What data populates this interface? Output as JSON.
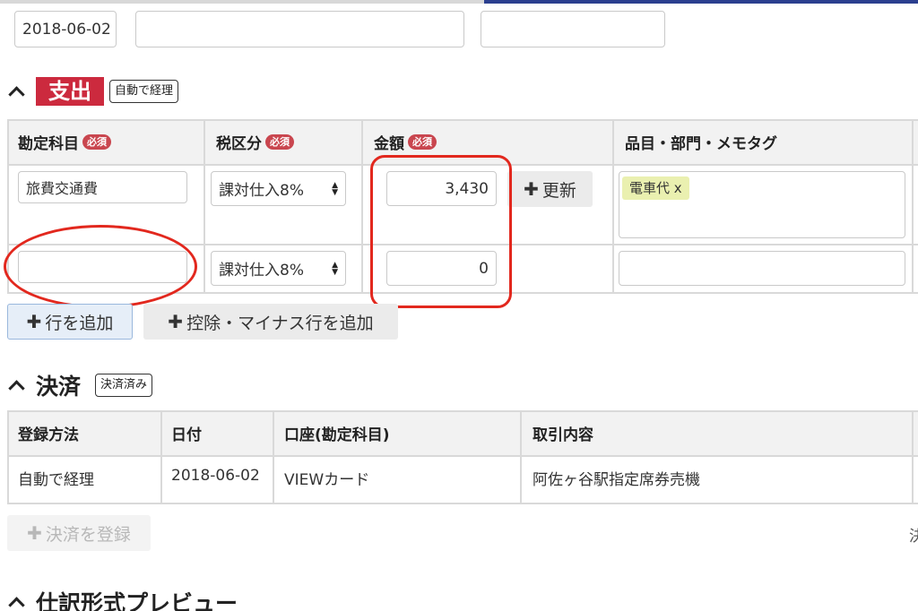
{
  "top_row": {
    "date_value": "2018-06-02",
    "field2_value": "",
    "field3_value": ""
  },
  "expense_section": {
    "title": "支出",
    "badge": "自動で経理",
    "required_label": "必須",
    "columns": [
      "勘定科目",
      "税区分",
      "金額",
      "品目・部門・メモタグ"
    ],
    "rows": [
      {
        "account": "旅費交通費",
        "tax": "課対仕入8%",
        "amount": "3,430",
        "tag": "電車代 x"
      },
      {
        "account": "",
        "tax": "課対仕入8%",
        "amount": "0",
        "tag": ""
      }
    ],
    "update_button": "更新",
    "add_row_button": "行を追加",
    "add_deduction_button": "控除・マイナス行を追加"
  },
  "settlement_section": {
    "title": "決済",
    "badge": "決済済み",
    "columns": [
      "登録方法",
      "日付",
      "口座(勘定科目)",
      "取引内容"
    ],
    "rows": [
      {
        "method": "自動で経理",
        "date": "2018-06-02",
        "account": "VIEWカード",
        "description": "阿佐ヶ谷駅指定席券売機"
      }
    ],
    "register_button": "決済を登録",
    "edge_text": "決"
  },
  "preview_section": {
    "title": "仕訳形式プレビュー"
  },
  "colors": {
    "expense_badge": "#cc2a3e",
    "required_badge": "#c9464f",
    "tag_bg": "#eaf0b0",
    "annotation": "#e2281e",
    "top_strip_blue": "#2b3f8f"
  }
}
